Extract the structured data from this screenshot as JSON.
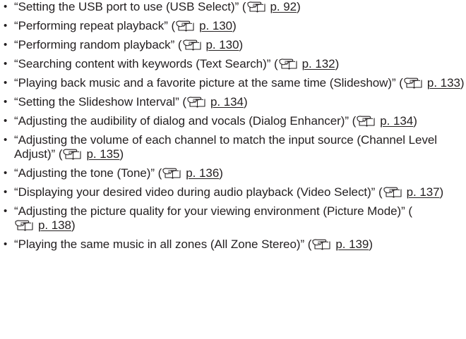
{
  "reference_icon": "hand-pointing-page-icon",
  "items": [
    {
      "text": "“Setting the USB port to use (USB Select)” (",
      "page": "p. 92",
      "close": ")"
    },
    {
      "text": "“Performing repeat playback” (",
      "page": "p. 130",
      "close": ")"
    },
    {
      "text": "“Performing random playback” (",
      "page": "p. 130",
      "close": ")"
    },
    {
      "text": "“Searching content with keywords (Text Search)” (",
      "page": "p. 132",
      "close": ")"
    },
    {
      "text": "“Playing back music and a favorite picture at the same time (Slideshow)” (",
      "page": "p. 133",
      "close": ")"
    },
    {
      "text": "“Setting the Slideshow Interval” (",
      "page": "p. 134",
      "close": ")"
    },
    {
      "text": "“Adjusting the audibility of dialog and vocals (Dialog Enhancer)” (",
      "page": "p. 134",
      "close": ")"
    },
    {
      "text": "“Adjusting the volume of each channel to match the input source (Channel Level Adjust)” (",
      "page": "p. 135",
      "close": ")"
    },
    {
      "text": "“Adjusting the tone (Tone)” (",
      "page": "p. 136",
      "close": ")"
    },
    {
      "text": "“Displaying your desired video during audio playback (Video Select)” (",
      "page": "p. 137",
      "close": ")"
    },
    {
      "text": "“Adjusting the picture quality for your viewing environment (Picture Mode)” (",
      "page": "p. 138",
      "close": ")"
    },
    {
      "text": "“Playing the same music in all zones (All Zone Stereo)” (",
      "page": "p. 139",
      "close": ")"
    }
  ]
}
